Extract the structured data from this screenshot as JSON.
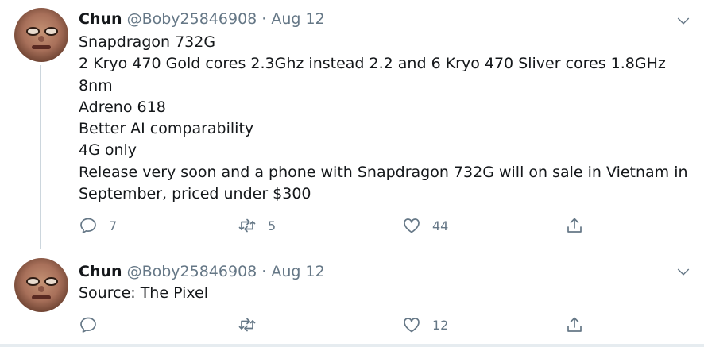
{
  "tweets": [
    {
      "author_name": "Chun",
      "handle": "@Boby25846908",
      "separator": "·",
      "date": "Aug 12",
      "lines": [
        "Snapdragon 732G",
        "2 Kryo 470 Gold cores 2.3Ghz instead 2.2 and 6 Kryo 470 Sliver cores 1.8GHz",
        "8nm",
        "Adreno 618",
        "Better AI comparability",
        "4G only",
        "Release very soon and a phone with Snapdragon 732G will on sale in Vietnam in",
        "September, priced under $300"
      ],
      "replies": "7",
      "retweets": "5",
      "likes": "44"
    },
    {
      "author_name": "Chun",
      "handle": "@Boby25846908",
      "separator": "·",
      "date": "Aug 12",
      "lines": [
        "Source: The Pixel"
      ],
      "replies": "",
      "retweets": "",
      "likes": "12"
    }
  ],
  "colors": {
    "text": "#14171a",
    "secondary": "#657786",
    "thread_line": "#ccd6dd",
    "divider": "#e6ecf0"
  }
}
